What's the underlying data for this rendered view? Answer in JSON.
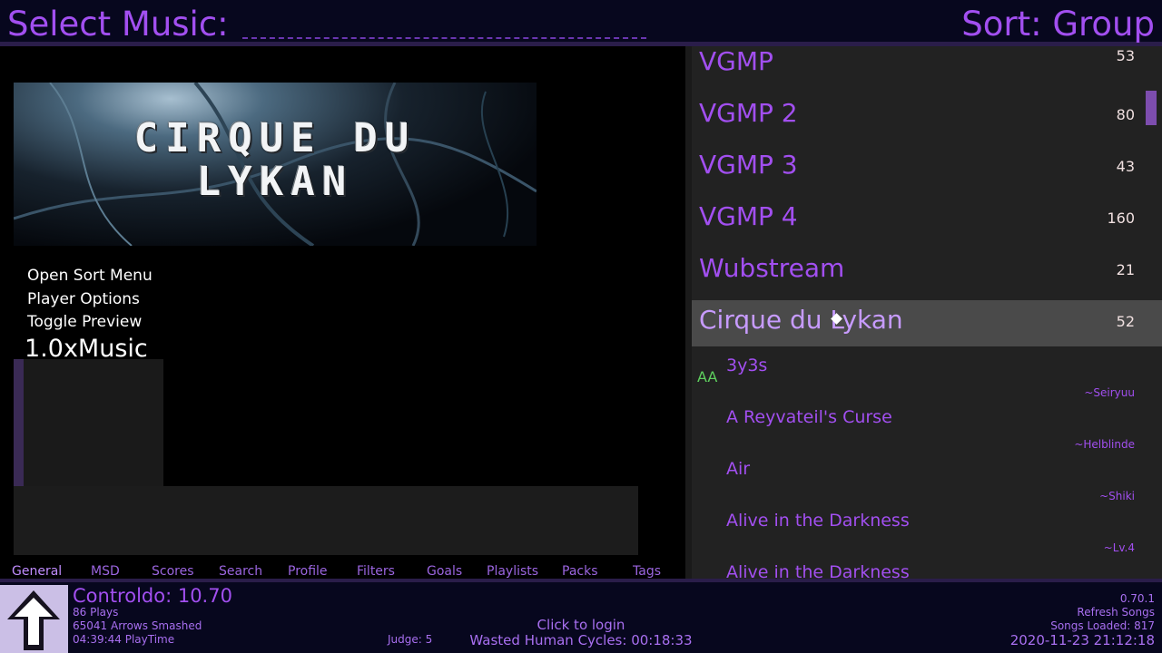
{
  "header": {
    "title": "Select Music:",
    "sort": "Sort: Group"
  },
  "banner": {
    "line1": "CIRQUE DU",
    "line2": "LYKAN"
  },
  "menu": {
    "items": [
      "Open Sort Menu",
      "Player Options",
      "Toggle Preview"
    ],
    "rate": "1.0xMusic"
  },
  "tabs": [
    "General",
    "MSD",
    "Scores",
    "Search",
    "Profile",
    "Filters",
    "Goals",
    "Playlists",
    "Packs",
    "Tags"
  ],
  "wheel": {
    "groups": [
      {
        "name": "VGMP",
        "count": "53"
      },
      {
        "name": "VGMP 2",
        "count": "80"
      },
      {
        "name": "VGMP 3",
        "count": "43"
      },
      {
        "name": "VGMP 4",
        "count": "160"
      },
      {
        "name": "Wubstream",
        "count": "21"
      },
      {
        "name": "Cirque du Lykan",
        "count": "52"
      }
    ],
    "songs": [
      {
        "title": "3y3s",
        "artist": "~Seiryuu",
        "grade": "AA"
      },
      {
        "title": "A Reyvateil's Curse",
        "artist": "~Helblinde",
        "grade": ""
      },
      {
        "title": "Air",
        "artist": "~Shiki",
        "grade": ""
      },
      {
        "title": "Alive in the Darkness",
        "artist": "~Lv.4",
        "grade": ""
      },
      {
        "title": "Alive in the Darkness",
        "artist": "",
        "grade": ""
      }
    ]
  },
  "profile": {
    "name": "Controldo: 10.70",
    "plays": "86 Plays",
    "arrows": "65041 Arrows Smashed",
    "playtime": "04:39:44 PlayTime",
    "judge": "Judge: 5"
  },
  "footer": {
    "login": "Click to login",
    "wasted": "Wasted Human Cycles: 00:18:33",
    "version": "0.70.1",
    "refresh": "Refresh Songs",
    "songs_loaded": "Songs Loaded: 817",
    "datetime": "2020-11-23 21:12:18"
  },
  "colors": {
    "accent": "#a24ff0",
    "background": "#07071e",
    "selected_row": "#4a4a4a",
    "grade_aa": "#5ed05e"
  }
}
